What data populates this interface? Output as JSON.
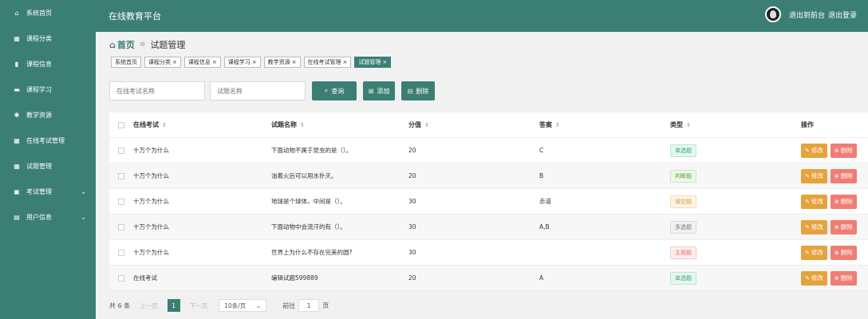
{
  "sidebar": {
    "items": [
      {
        "label": "系统首页",
        "icon": "home-icon"
      },
      {
        "label": "课程分类",
        "icon": "grid-icon"
      },
      {
        "label": "课程信息",
        "icon": "bar-chart-icon"
      },
      {
        "label": "课程学习",
        "icon": "chat-icon"
      },
      {
        "label": "教学资源",
        "icon": "gear-icon"
      },
      {
        "label": "在线考试管理",
        "icon": "grid-icon"
      },
      {
        "label": "试题管理",
        "icon": "grid-icon"
      },
      {
        "label": "考试管理",
        "icon": "calendar-icon"
      },
      {
        "label": "用户信息",
        "icon": "card-icon"
      }
    ]
  },
  "header": {
    "title": "在线教育平台",
    "back_label": "退出到前台",
    "logout_label": "退出登录"
  },
  "breadcrumb": {
    "home": "首页",
    "current": "试题管理"
  },
  "tags": [
    {
      "label": "系统首页",
      "closable": false
    },
    {
      "label": "课程分类",
      "closable": true
    },
    {
      "label": "课程信息",
      "closable": true
    },
    {
      "label": "课程学习",
      "closable": true
    },
    {
      "label": "教学资源",
      "closable": true
    },
    {
      "label": "在线考试管理",
      "closable": true
    },
    {
      "label": "试题管理",
      "closable": true
    }
  ],
  "search": {
    "exam_placeholder": "在线考试名称",
    "name_placeholder": "试题名称",
    "query_label": "查询",
    "add_label": "添加",
    "delete_label": "删除"
  },
  "table": {
    "headers": {
      "exam": "在线考试",
      "name": "试题名称",
      "score": "分值",
      "answer": "答案",
      "type": "类型",
      "op": "操作"
    },
    "edit_label": "修改",
    "delete_label": "删除",
    "rows": [
      {
        "exam": "十万个为什么",
        "name": "下面动物不属于昆虫的是（）。",
        "score": "20",
        "answer": "C",
        "type": "单选题"
      },
      {
        "exam": "十万个为什么",
        "name": "油着火后可以用水扑灭。",
        "score": "20",
        "answer": "B",
        "type": "判断题"
      },
      {
        "exam": "十万个为什么",
        "name": "地球是个球体，中间是（）。",
        "score": "30",
        "answer": "赤道",
        "type": "填空题"
      },
      {
        "exam": "十万个为什么",
        "name": "下面动物中会流汗的有（）。",
        "score": "30",
        "answer": "A,B",
        "type": "多选题"
      },
      {
        "exam": "十万个为什么",
        "name": "世界上为什么不存在完美的圆?",
        "score": "30",
        "answer": "",
        "type": "主观题"
      },
      {
        "exam": "在线考试",
        "name": "编辑试题599889",
        "score": "20",
        "answer": "A",
        "type": "单选题"
      }
    ]
  },
  "badge_colors": {
    "单选题": {
      "fg": "#3aa57a",
      "bg": "#e6f6ef",
      "border": "#bfe6d3"
    },
    "判断题": {
      "fg": "#5aa03a",
      "bg": "#eef7e6",
      "border": "#cde6bc"
    },
    "填空题": {
      "fg": "#d89a3b",
      "bg": "#fdf4e6",
      "border": "#f3ddb6"
    },
    "多选题": {
      "fg": "#777777",
      "bg": "#f1f1f1",
      "border": "#d9d9d9"
    },
    "主观题": {
      "fg": "#e06c6c",
      "bg": "#fdeeee",
      "border": "#f3c9c9"
    }
  },
  "pager": {
    "total": "共 6 条",
    "prev": "上一页",
    "page": "1",
    "next": "下一页",
    "size": "10条/页",
    "goto": "前往",
    "goto_value": "1",
    "page_unit": "页"
  }
}
